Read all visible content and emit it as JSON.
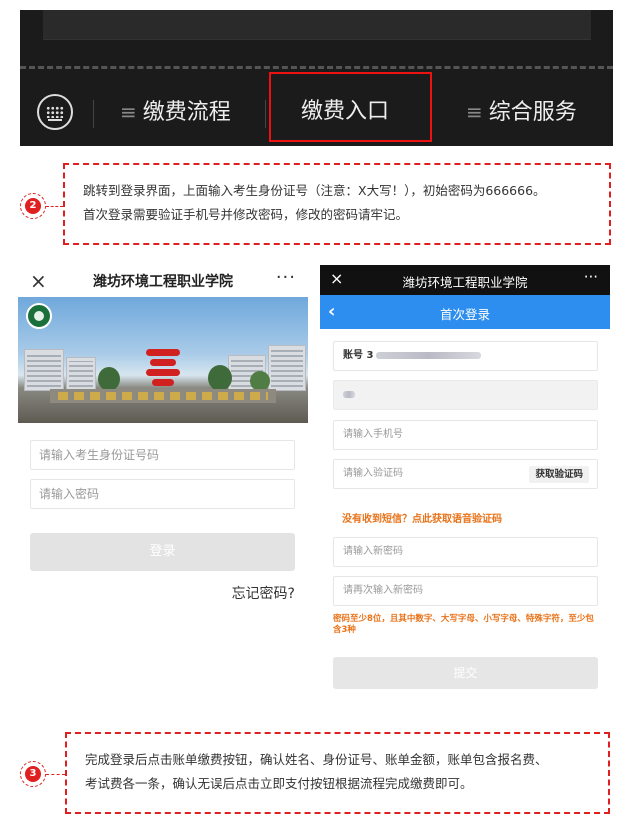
{
  "menu": {
    "items": [
      {
        "label": "缴费流程",
        "active": false
      },
      {
        "label": "缴费入口",
        "active": true
      },
      {
        "label": "综合服务",
        "active": false
      }
    ],
    "hamburger_symbol": "≡",
    "highlight_color": "#ee1111"
  },
  "steps": {
    "step2": {
      "number": "2",
      "line1": "跳转到登录界面，上面输入考生身份证号（注意：X大写！），初始密码为666666。",
      "line2": "首次登录需要验证手机号并修改密码，修改的密码请牢记。"
    },
    "step3": {
      "number": "3",
      "line1": "完成登录后点击账单缴费按钮，确认姓名、身份证号、账单金额，账单包含报名费、",
      "line2": "考试费各一条，确认无误后点击立即支付按钮根据流程完成缴费即可。"
    }
  },
  "login_screen": {
    "close_icon": "×",
    "title": "潍坊环境工程职业学院",
    "more_icon": "···",
    "id_placeholder": "请输入考生身份证号码",
    "password_placeholder": "请输入密码",
    "login_label": "登录",
    "forgot_label": "忘记密码?"
  },
  "first_login_screen": {
    "close_icon": "×",
    "title": "潍坊环境工程职业学院",
    "more_icon": "···",
    "back_icon": "‹",
    "nav_title": "首次登录",
    "account_label": "账号 3",
    "phone_placeholder": "请输入手机号",
    "code_placeholder": "请输入验证码",
    "get_code_label": "获取验证码",
    "voice_code_link": "没有收到短信？点此获取语音验证码",
    "new_password_placeholder": "请输入新密码",
    "confirm_password_placeholder": "请再次输入新密码",
    "password_rule": "密码至少8位，且其中数字、大写字母、小写字母、特殊字符，至少包含3种",
    "submit_label": "提交",
    "nav_color": "#2d8ef0",
    "warning_color": "#e8731a"
  }
}
